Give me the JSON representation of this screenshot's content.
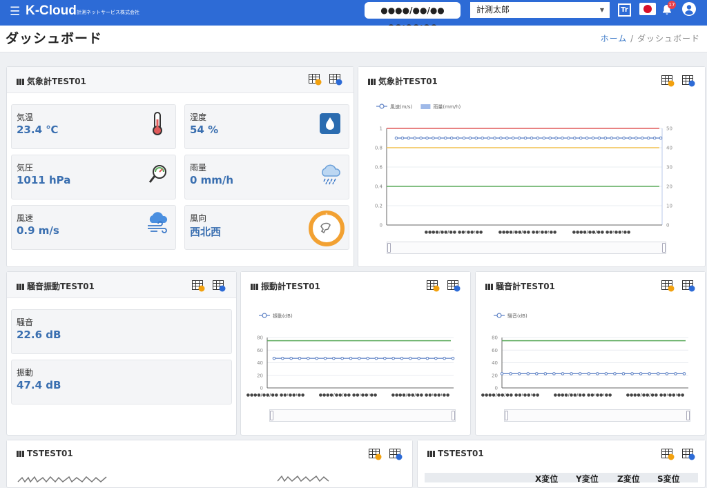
{
  "header": {
    "app_name": "K-Cloud",
    "company": "計測ネットサービス株式会社",
    "datetime": "●●●●/●●/●● ●●:●●:●●",
    "user_select": "計測太郎",
    "font_icon_label": "Tr",
    "notification_count": "17"
  },
  "page": {
    "title": "ダッシュボード",
    "breadcrumb_home": "ホーム",
    "breadcrumb_sep": "/",
    "breadcrumb_current": "ダッシュボード"
  },
  "weather_panel": {
    "title": "気象計TEST01",
    "tiles": [
      {
        "label": "気温",
        "value": "23.4 ℃",
        "icon": "thermometer-icon"
      },
      {
        "label": "湿度",
        "value": "54 %",
        "icon": "humidity-drop-icon"
      },
      {
        "label": "気圧",
        "value": "1011 hPa",
        "icon": "barometer-icon"
      },
      {
        "label": "雨量",
        "value": "0 mm/h",
        "icon": "rain-cloud-icon"
      },
      {
        "label": "風速",
        "value": "0.9 m/s",
        "icon": "wind-cloud-icon"
      },
      {
        "label": "風向",
        "value": "西北西",
        "icon": "compass-icon"
      }
    ]
  },
  "noise_panel": {
    "title": "騒音振動TEST01",
    "tiles": [
      {
        "label": "騒音",
        "value": "22.6 dB"
      },
      {
        "label": "振動",
        "value": "47.4 dB"
      }
    ]
  },
  "ts_panels": {
    "left_title": "TSTEST01",
    "right_title": "TSTEST01"
  },
  "ts_table": {
    "columns": [
      "X変位",
      "Y変位",
      "Z変位",
      "S変位"
    ]
  },
  "colors": {
    "brand": "#2d6bd6",
    "value_text": "#3a6fb0",
    "line_red": "#e05a5a",
    "line_yellow": "#f2c14e",
    "line_green": "#5aaa5a",
    "series": "#5a7fc4"
  },
  "chart_data": [
    {
      "type": "line",
      "title": "気象計TEST01",
      "x": [
        "●●●●/●●/●● ●●:●●:●●",
        "●●●●/●●/●● ●●:●●:●●",
        "●●●●/●●/●● ●●:●●:●●"
      ],
      "y_ticks": [
        "0",
        "0.2",
        "0.4",
        "0.6",
        "0.8",
        "1"
      ],
      "y2_ticks": [
        "0",
        "10",
        "20",
        "30",
        "40",
        "50"
      ],
      "ylim": [
        0,
        1
      ],
      "y2lim": [
        0,
        50
      ],
      "series": [
        {
          "name": "風速(m/s)",
          "axis": "left",
          "value": 0.9,
          "points": 44
        },
        {
          "name": "雨量(mm/h)",
          "axis": "right",
          "value": 0
        }
      ],
      "threshold_lines": [
        1.0,
        0.8,
        0.4
      ],
      "legend": "top-left"
    },
    {
      "type": "line",
      "title": "振動計TEST01",
      "x": [
        "●●●●/●●/●● ●●:●●:●●",
        "●●●●/●●/●● ●●:●●:●●",
        "●●●●/●●/●● ●●:●●:●●"
      ],
      "y_ticks": [
        "0",
        "20",
        "40",
        "60",
        "80"
      ],
      "ylim": [
        0,
        80
      ],
      "series": [
        {
          "name": "振動(dB)",
          "value": 47,
          "points": 22
        }
      ],
      "threshold_lines": [
        75
      ],
      "legend": "top-left"
    },
    {
      "type": "line",
      "title": "騒音計TEST01",
      "x": [
        "●●●●/●●/●● ●●:●●:●●",
        "●●●●/●●/●● ●●:●●:●●",
        "●●●●/●●/●● ●●:●●:●●"
      ],
      "y_ticks": [
        "0",
        "20",
        "40",
        "60",
        "80"
      ],
      "ylim": [
        0,
        80
      ],
      "series": [
        {
          "name": "騒音(dB)",
          "value": 22.6,
          "points": 22
        }
      ],
      "threshold_lines": [
        75
      ],
      "legend": "top-left"
    }
  ]
}
